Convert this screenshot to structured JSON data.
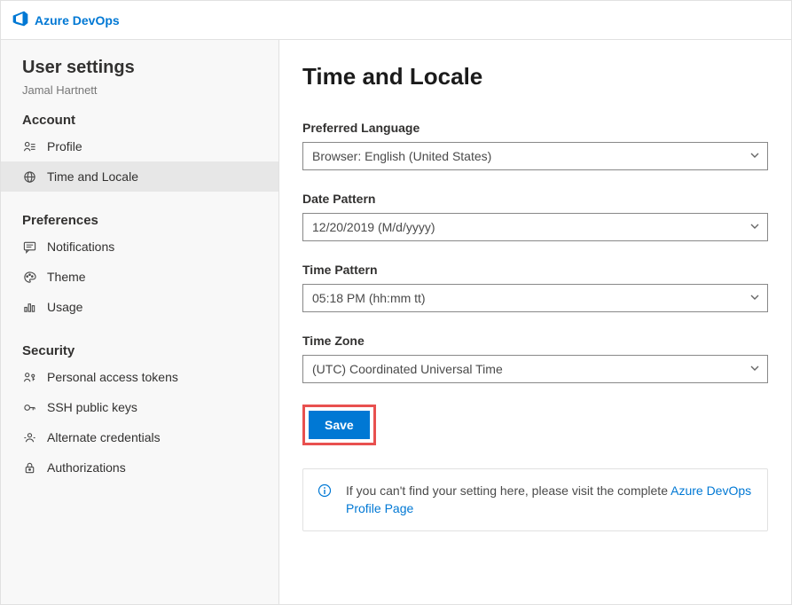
{
  "brand": {
    "name": "Azure DevOps"
  },
  "sidebar": {
    "title": "User settings",
    "user": "Jamal Hartnett",
    "sections": {
      "account": {
        "label": "Account"
      },
      "preferences": {
        "label": "Preferences"
      },
      "security": {
        "label": "Security"
      }
    },
    "items": {
      "profile": "Profile",
      "timeLocale": "Time and Locale",
      "notifications": "Notifications",
      "theme": "Theme",
      "usage": "Usage",
      "pat": "Personal access tokens",
      "ssh": "SSH public keys",
      "altCreds": "Alternate credentials",
      "authz": "Authorizations"
    }
  },
  "main": {
    "title": "Time and Locale",
    "language": {
      "label": "Preferred Language",
      "value": "Browser: English (United States)"
    },
    "datePattern": {
      "label": "Date Pattern",
      "value": "12/20/2019 (M/d/yyyy)"
    },
    "timePattern": {
      "label": "Time Pattern",
      "value": "05:18 PM (hh:mm tt)"
    },
    "timeZone": {
      "label": "Time Zone",
      "value": "(UTC) Coordinated Universal Time"
    },
    "saveLabel": "Save",
    "info": {
      "prefix": "If you can't find your setting here, please visit the complete ",
      "linkText": "Azure DevOps Profile Page"
    }
  }
}
